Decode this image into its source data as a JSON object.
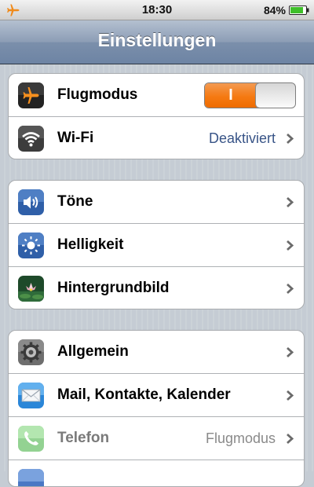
{
  "status_bar": {
    "time": "18:30",
    "battery_percent": "84%",
    "left_icon": "airplane-icon",
    "battery_level": 0.84
  },
  "nav": {
    "title": "Einstellungen"
  },
  "groups": [
    {
      "rows": [
        {
          "label": "Flugmodus",
          "icon": "airplane-icon",
          "toggle_on_label": "I",
          "toggle_state": "on"
        },
        {
          "label": "Wi-Fi",
          "icon": "wifi-icon",
          "value": "Deaktiviert"
        }
      ]
    },
    {
      "rows": [
        {
          "label": "Töne",
          "icon": "speaker-icon"
        },
        {
          "label": "Helligkeit",
          "icon": "brightness-icon"
        },
        {
          "label": "Hintergrundbild",
          "icon": "wallpaper-icon"
        }
      ]
    },
    {
      "rows": [
        {
          "label": "Allgemein",
          "icon": "gear-icon"
        },
        {
          "label": "Mail, Kontakte, Kalender",
          "icon": "mail-icon"
        },
        {
          "label": "Telefon",
          "icon": "phone-icon",
          "value": "Flugmodus"
        }
      ]
    }
  ],
  "colors": {
    "value_text": "#385487",
    "toggle_on": "#f57a12",
    "nav_bar": "#6d84a4"
  }
}
